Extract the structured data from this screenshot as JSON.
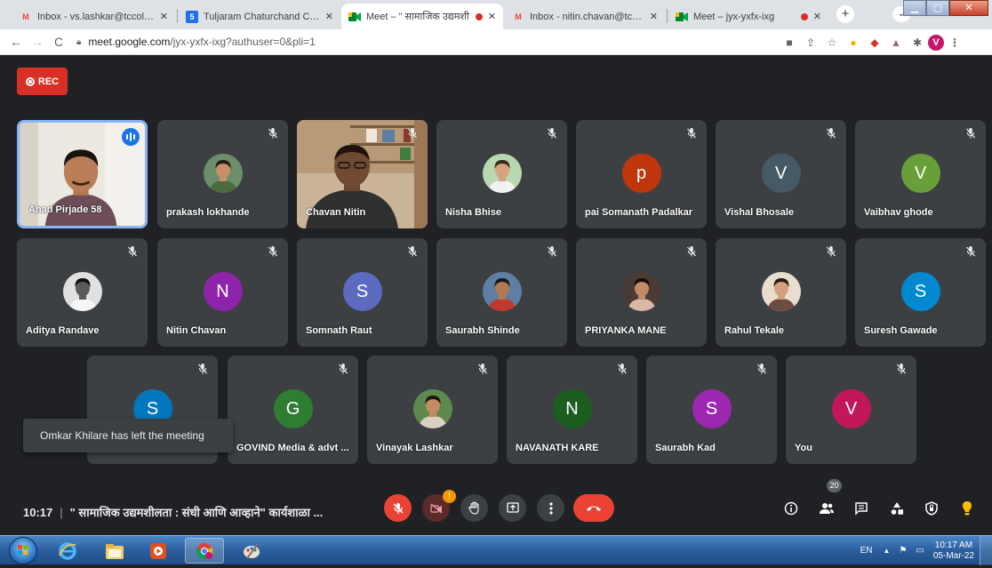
{
  "browser": {
    "tabs": [
      {
        "title": "Inbox - vs.lashkar@tccollege.org",
        "icon": "gmail-icon",
        "active": false
      },
      {
        "title": "Tuljaram Chaturchand College",
        "icon": "site-5-icon",
        "active": false
      },
      {
        "title": "Meet – \" सामाजिक उद्यमशी",
        "icon": "meet-icon",
        "active": true,
        "recording": true
      },
      {
        "title": "Inbox - nitin.chavan@tccollege.org",
        "icon": "gmail-icon",
        "active": false
      },
      {
        "title": "Meet – jyx-yxfx-ixg",
        "icon": "meet-icon",
        "active": false,
        "recording": true
      }
    ],
    "new_tab": "+",
    "url_host": "meet.google.com",
    "url_path": "/jyx-yxfx-ixg?authuser=0&pli=1",
    "profile_initial": "V"
  },
  "meet": {
    "rec_label": "REC",
    "participants": [
      {
        "name": "Ahad Pirjade 58",
        "type": "video",
        "speaking": true
      },
      {
        "name": "prakash lokhande",
        "type": "photo",
        "photo": "man-beard"
      },
      {
        "name": "Chavan Nitin",
        "type": "video"
      },
      {
        "name": "Nisha Bhise",
        "type": "photo",
        "photo": "woman-outdoor"
      },
      {
        "name": "pai Somanath Padalkar",
        "type": "initial",
        "initial": "p",
        "color": "#bf360c"
      },
      {
        "name": "Vishal Bhosale",
        "type": "initial",
        "initial": "V",
        "color": "#455a64"
      },
      {
        "name": "Vaibhav ghode",
        "type": "initial",
        "initial": "V",
        "color": "#689f38"
      },
      {
        "name": "Aditya Randave",
        "type": "photo",
        "photo": "man-bw"
      },
      {
        "name": "Nitin Chavan",
        "type": "initial",
        "initial": "N",
        "color": "#8e24aa"
      },
      {
        "name": "Somnath Raut",
        "type": "initial",
        "initial": "S",
        "color": "#5c6bc0"
      },
      {
        "name": "Saurabh Shinde",
        "type": "photo",
        "photo": "group-flags"
      },
      {
        "name": "PRIYANKA MANE",
        "type": "photo",
        "photo": "woman-dark"
      },
      {
        "name": "Rahul Tekale",
        "type": "photo",
        "photo": "man-light"
      },
      {
        "name": "Suresh Gawade",
        "type": "initial",
        "initial": "S",
        "color": "#0288d1"
      },
      {
        "name": "",
        "type": "initial",
        "initial": "S",
        "color": "#0277bd"
      },
      {
        "name": "GOVIND Media & advt ...",
        "type": "initial",
        "initial": "G",
        "color": "#2e7d32"
      },
      {
        "name": "Vinayak Lashkar",
        "type": "photo",
        "photo": "man-beard-2"
      },
      {
        "name": "NAVANATH KARE",
        "type": "initial",
        "initial": "N",
        "color": "#1b5e20"
      },
      {
        "name": "Saurabh Kad",
        "type": "initial",
        "initial": "S",
        "color": "#9c27b0"
      },
      {
        "name": "You",
        "type": "initial",
        "initial": "V",
        "color": "#c2185b"
      }
    ],
    "toast": "Omkar Khilare has left the meeting",
    "bottom": {
      "time": "10:17",
      "separator": "|",
      "meeting_title": "\" सामाजिक उद्यमशीलता : संधी आणि आव्हाने\" कार्यशाळा ...",
      "camera_badge": "!",
      "people_count": "20"
    }
  },
  "taskbar": {
    "lang": "EN",
    "time": "10:17 AM",
    "date": "05-Mar-22"
  }
}
